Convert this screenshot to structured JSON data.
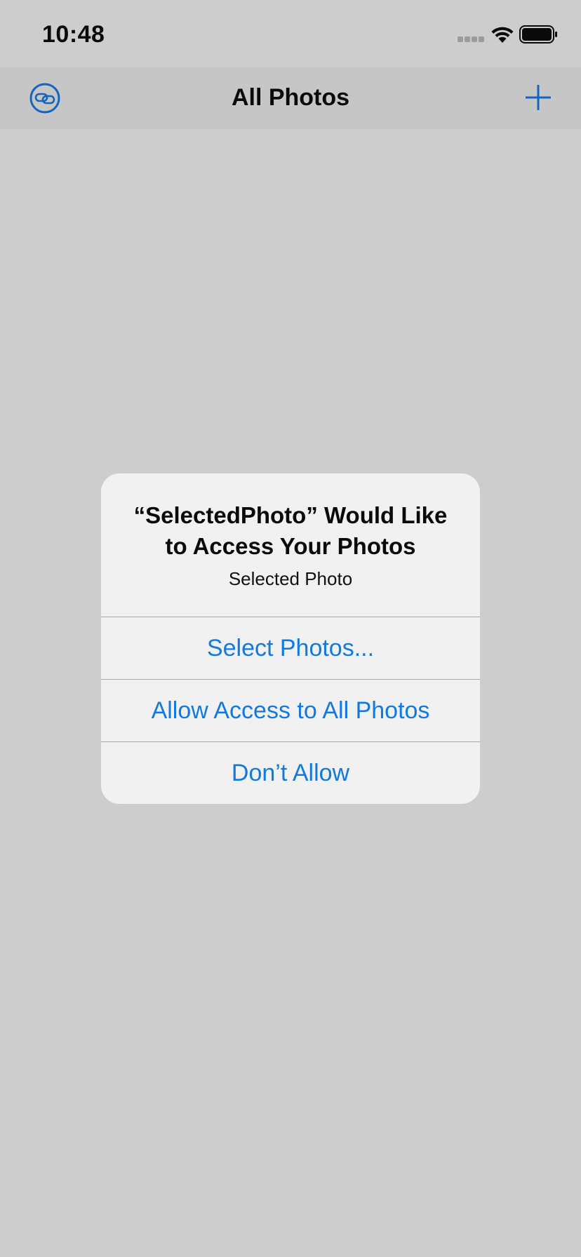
{
  "status_bar": {
    "time": "10:48",
    "icons": [
      "cellular-signal-icon",
      "wifi-icon",
      "battery-icon"
    ]
  },
  "nav_bar": {
    "title": "All Photos",
    "left_icon": "link-icon",
    "right_icon": "plus-icon",
    "tint_color": "#1565c0"
  },
  "alert": {
    "title": "“SelectedPhoto” Would Like to Access Your Photos",
    "message": "Selected Photo",
    "actions": [
      {
        "label": "Select Photos..."
      },
      {
        "label": "Allow Access to All Photos"
      },
      {
        "label": "Don’t Allow"
      }
    ],
    "action_color": "#1279e0"
  }
}
